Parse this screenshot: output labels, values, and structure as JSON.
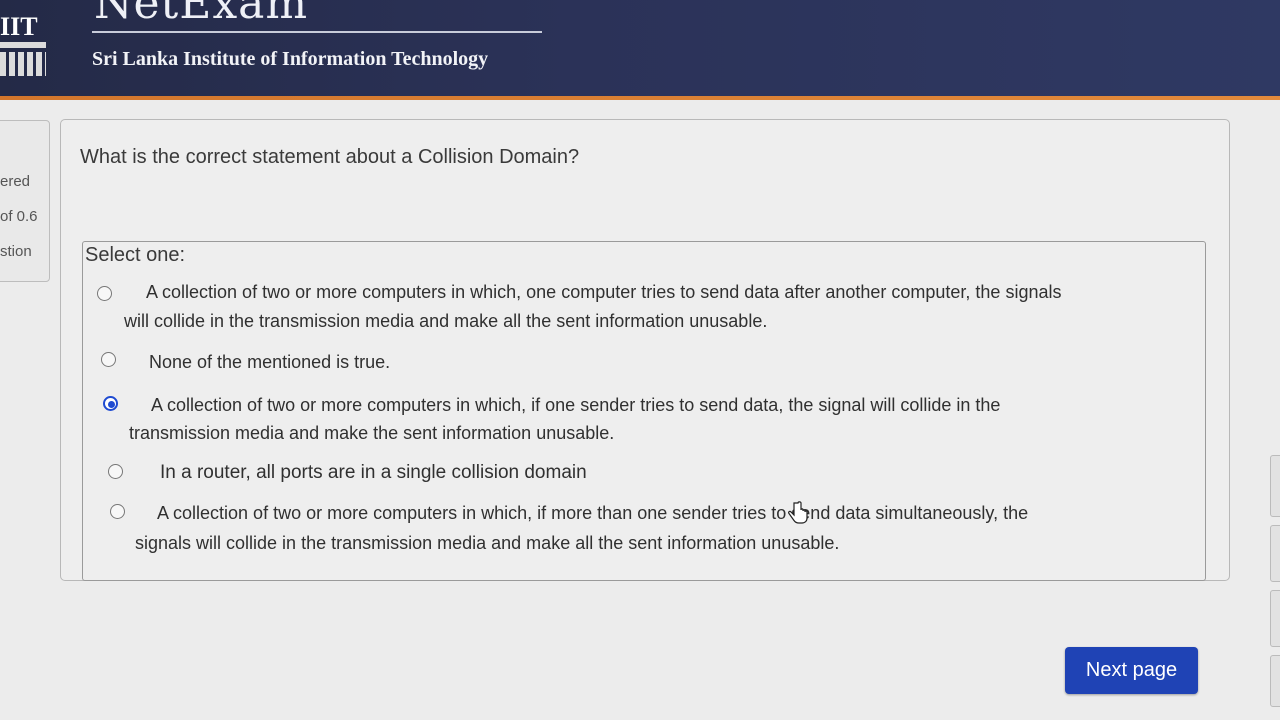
{
  "header": {
    "logo_text": "IIT",
    "app_title": "NetExam",
    "subtitle": "Sri Lanka Institute of Information Technology"
  },
  "sidebar_info": {
    "status": "ered",
    "mark": "of 0.6",
    "flag": "stion"
  },
  "question": {
    "text": "What is the correct statement about a Collision Domain?",
    "prompt": "Select one:",
    "options": [
      {
        "line1": "A collection of two or more computers in which, one computer tries to send data after another computer, the signals",
        "line2": "will collide in the transmission media and make all the sent information unusable.",
        "selected": false
      },
      {
        "line1": "None of the mentioned is true.",
        "line2": "",
        "selected": false
      },
      {
        "line1": "A collection of two or more computers in which, if one sender tries to send data, the signal will collide in the",
        "line2": "transmission media and make the sent information unusable.",
        "selected": true
      },
      {
        "line1": "In a router, all ports are in a single collision domain",
        "line2": "",
        "selected": false
      },
      {
        "line1": "A collection of two or more computers in which, if more than one sender tries to send data simultaneously, the",
        "line2": "signals will collide in the transmission media and make all the sent information unusable.",
        "selected": false
      }
    ]
  },
  "navigation": {
    "next_label": "Next page"
  },
  "colors": {
    "header_bg": "#2b3258",
    "header_accent": "#e38a3b",
    "button_bg": "#1f43b5",
    "radio_selected": "#1f4bd1"
  }
}
